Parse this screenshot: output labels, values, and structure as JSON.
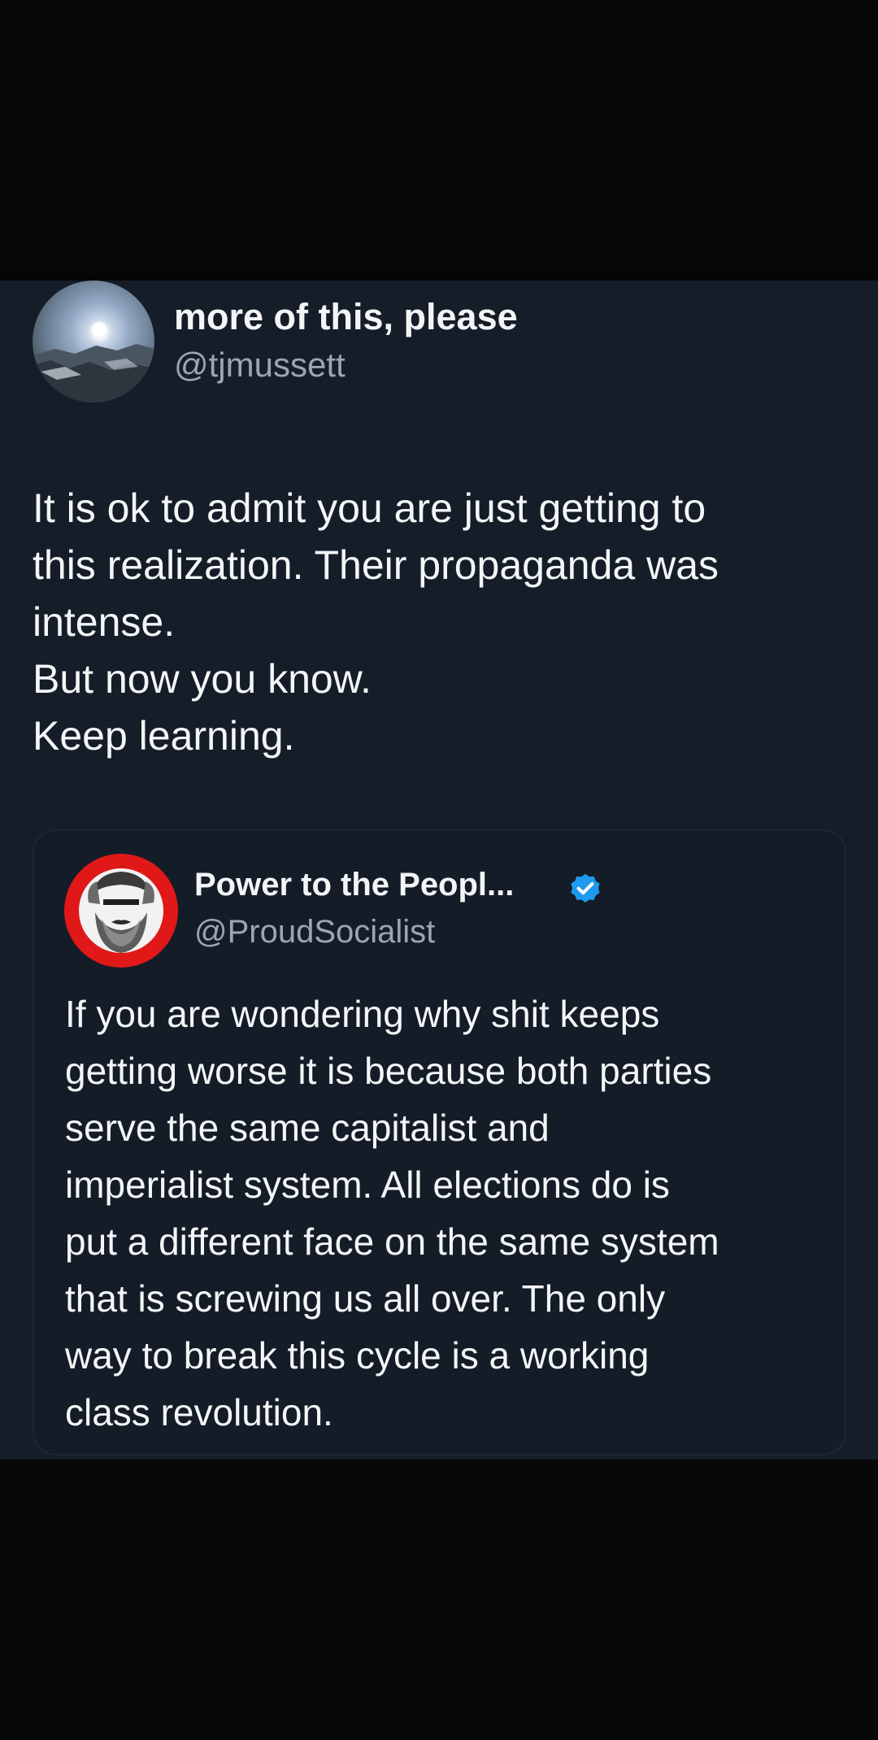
{
  "tweet": {
    "author": {
      "display_name": "more of this, please",
      "handle": "@tjmussett",
      "avatar_icon": "landscape-photo-avatar"
    },
    "text_lines": [
      "It is ok to admit you are just getting to",
      "this realization.  Their propaganda was",
      "intense.",
      "But now you know.",
      "Keep learning."
    ]
  },
  "quoted_tweet": {
    "author": {
      "display_name": "Power to the Peopl...",
      "handle": "@ProudSocialist",
      "verified_icon": "verified-badge-icon",
      "avatar_icon": "bearded-portrait-avatar"
    },
    "text_lines": [
      "If you are wondering why shit keeps",
      "getting worse it is because both parties",
      "serve the same capitalist and",
      "imperialist system. All elections do is",
      "put a different face on the same system",
      "that is screwing us all over. The only",
      "way to break this cycle is a working",
      "class revolution."
    ]
  },
  "colors": {
    "card_background": "#151d28",
    "page_background": "#090a0c",
    "primary_text": "#f3f5f7",
    "secondary_text": "#9aa6b2",
    "verified_blue": "#1d9bf0",
    "avatar_red": "#e01818"
  }
}
